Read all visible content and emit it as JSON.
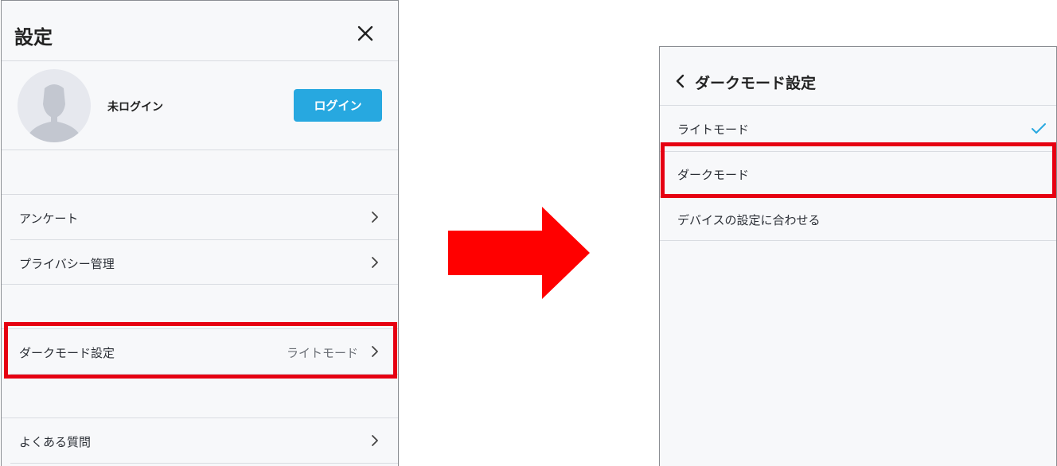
{
  "settings": {
    "title": "設定",
    "profile": {
      "name": "未ログイン",
      "login_label": "ログイン"
    },
    "items": [
      {
        "label": "アンケート",
        "value": ""
      },
      {
        "label": "プライバシー管理",
        "value": ""
      },
      {
        "label": "ダークモード設定",
        "value": "ライトモード"
      },
      {
        "label": "よくある質問",
        "value": ""
      }
    ]
  },
  "dark_mode": {
    "title": "ダークモード設定",
    "options": [
      {
        "label": "ライトモード",
        "selected": true
      },
      {
        "label": "ダークモード",
        "selected": false
      },
      {
        "label": "デバイスの設定に合わせる",
        "selected": false
      }
    ]
  },
  "colors": {
    "accent": "#27a8e0",
    "highlight": "#e60012",
    "arrow": "#ff0000",
    "panel_bg": "#f7f8fa"
  }
}
